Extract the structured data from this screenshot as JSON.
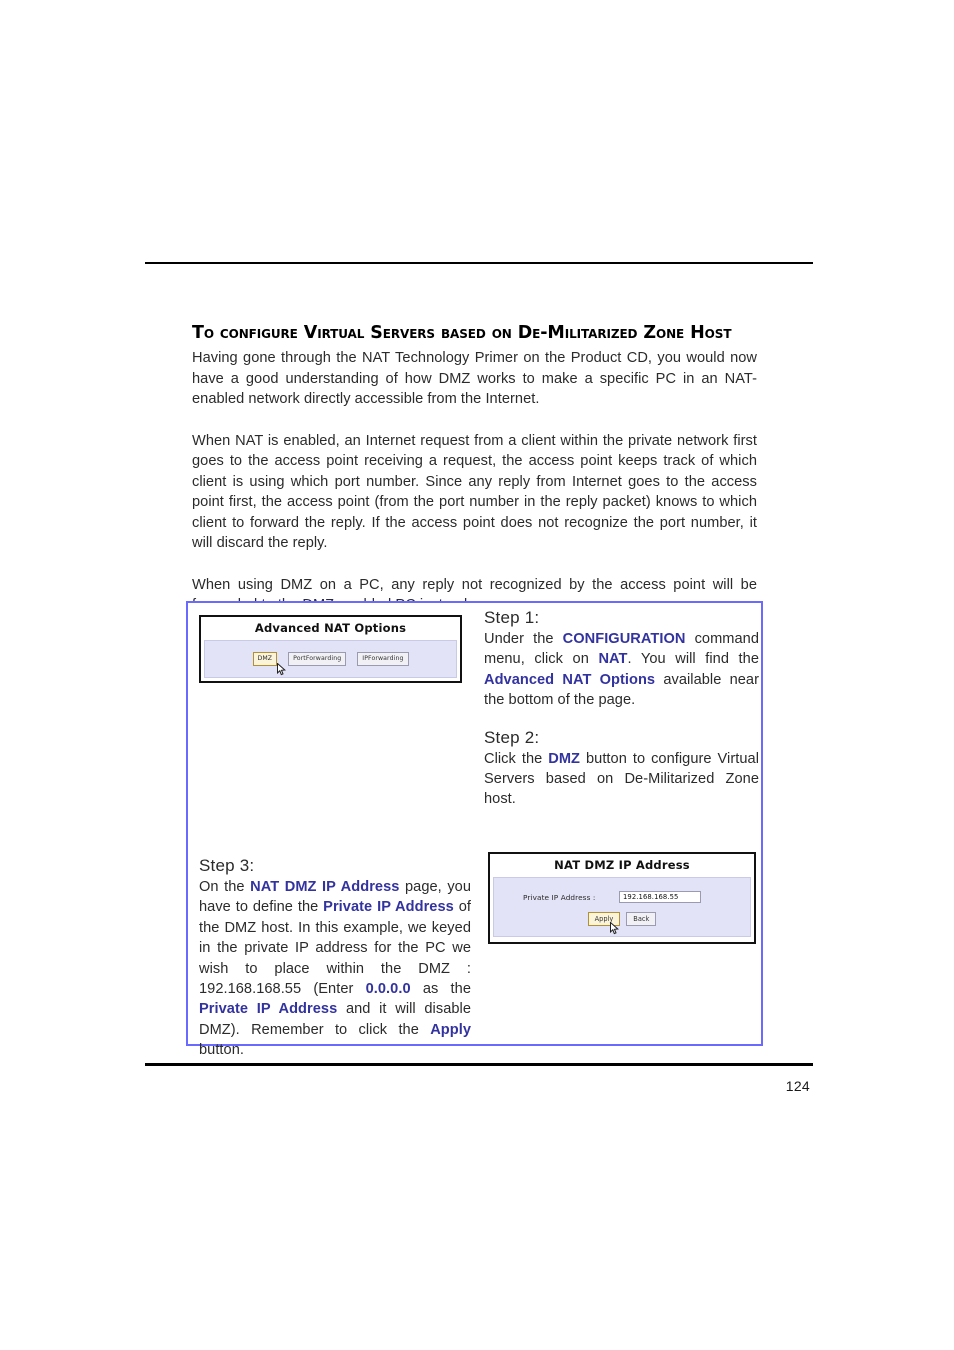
{
  "document": {
    "page_number": "124",
    "section_heading": "To configure Virtual Servers based on De-Militarized Zone Host",
    "paragraphs": [
      "Having gone through the NAT Technology Primer on the Product CD, you would now have a good understanding of how DMZ works to make a specific PC in an NAT-enabled network directly accessible from the Internet.",
      "When NAT is enabled, an Internet request from a client within the private network first goes to the access point receiving a request, the access point keeps track of which client is using which port number. Since any reply from Internet goes to the access point first, the access point (from the port number in the reply packet) knows to which client to forward the reply. If the access point does not recognize the port number, it will discard the reply.",
      "When using DMZ on a PC, any reply not recognized by the access point will be forwarded to the DMZ-enabled PC instead."
    ]
  },
  "colors": {
    "box_border": "#6a6aff",
    "highlight_blue": "#3333a0",
    "panel_background": "#e3e3f7",
    "active_button": "#fbf4d9",
    "rule": "#000000"
  },
  "steps": {
    "step1": {
      "title": "Step 1:",
      "text_parts": [
        {
          "t": "Under the ",
          "bold": false
        },
        {
          "t": "CONFIGURATION",
          "bold": true
        },
        {
          "t": " command menu, click on ",
          "bold": false
        },
        {
          "t": "NAT",
          "bold": true
        },
        {
          "t": ". You will find the ",
          "bold": false
        },
        {
          "t": "Advanced NAT Options",
          "bold": true
        },
        {
          "t": " available near the bottom of the page.",
          "bold": false
        }
      ]
    },
    "step2": {
      "title": "Step 2:",
      "text_parts": [
        {
          "t": "Click the ",
          "bold": false
        },
        {
          "t": "DMZ",
          "bold": true
        },
        {
          "t": " button to configure Virtual Servers based on De-Militarized Zone host.",
          "bold": false
        }
      ]
    },
    "step3": {
      "title": "Step 3:",
      "text_parts": [
        {
          "t": "On the ",
          "bold": false
        },
        {
          "t": "NAT DMZ IP Address",
          "bold": true
        },
        {
          "t": " page, you have to define the ",
          "bold": false
        },
        {
          "t": "Private IP Address",
          "bold": true
        },
        {
          "t": " of the DMZ host. In this example, we keyed in the private IP address for the PC we wish to place within the DMZ : 192.168.168.55 (Enter ",
          "bold": false
        },
        {
          "t": "0.0.0.0",
          "bold": true
        },
        {
          "t": " as the ",
          "bold": false
        },
        {
          "t": "Private IP Address",
          "bold": true
        },
        {
          "t": " and it will disable DMZ). Remember to click the ",
          "bold": false
        },
        {
          "t": "Apply",
          "bold": true
        },
        {
          "t": " button.",
          "bold": false
        }
      ]
    }
  },
  "screenshots": {
    "advanced_nat_options": {
      "title": "Advanced NAT Options",
      "buttons": [
        {
          "label": "DMZ",
          "state": "active"
        },
        {
          "label": "PortForwarding",
          "state": "normal"
        },
        {
          "label": "IPForwarding",
          "state": "normal"
        }
      ]
    },
    "nat_dmz_ip_address": {
      "title": "NAT DMZ IP Address",
      "field_label": "Private IP Address :",
      "field_value": "192.168.168.55",
      "buttons": [
        {
          "label": "Apply",
          "state": "active"
        },
        {
          "label": "Back",
          "state": "normal"
        }
      ]
    }
  }
}
